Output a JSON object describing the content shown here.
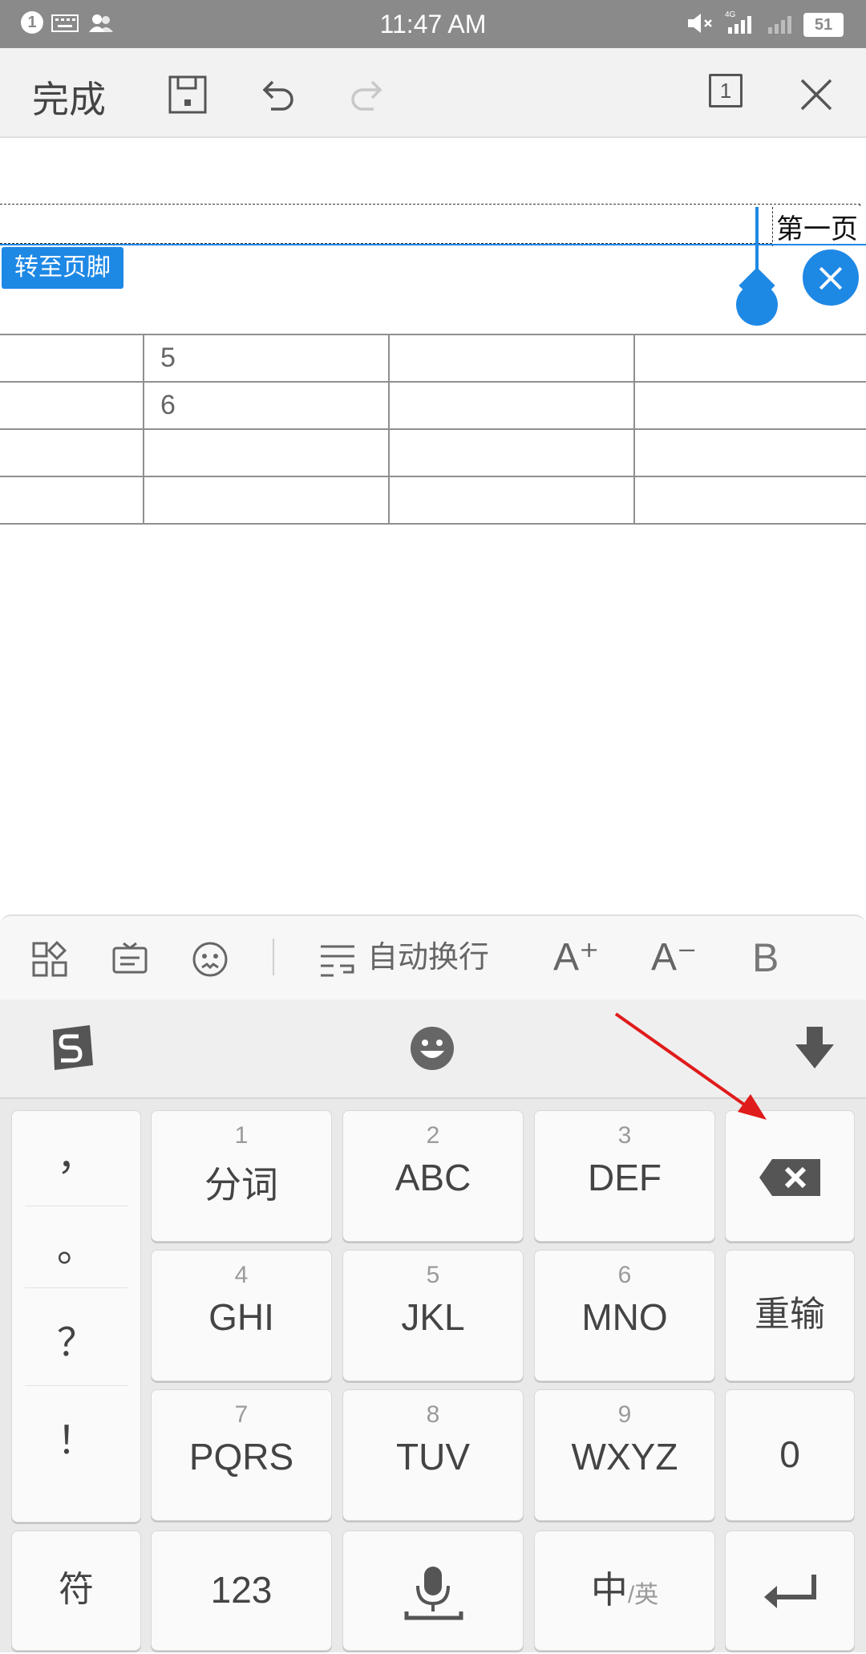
{
  "status_bar": {
    "time": "11:47 AM",
    "notification_count": "1",
    "network": "4G",
    "battery": "51"
  },
  "toolbar": {
    "done_label": "完成",
    "page_count": "1",
    "icons": [
      "save-icon",
      "undo-icon",
      "redo-icon",
      "page-count-icon",
      "close-icon"
    ]
  },
  "document": {
    "header_text": "第一页",
    "goto_footer_label": "转至页脚",
    "table": {
      "rows": [
        [
          "",
          "5",
          "",
          ""
        ],
        [
          "",
          "6",
          "",
          ""
        ],
        [
          "",
          "",
          "",
          ""
        ],
        [
          "",
          "",
          "",
          ""
        ]
      ]
    }
  },
  "format_bar": {
    "wrap_label": "自动换行",
    "increase_font": "A⁺",
    "decrease_font": "A⁻",
    "bold": "B"
  },
  "keyboard": {
    "punctuation": [
      "，",
      "。",
      "？",
      "！"
    ],
    "keys": [
      {
        "num": "1",
        "label": "分词"
      },
      {
        "num": "2",
        "label": "ABC"
      },
      {
        "num": "3",
        "label": "DEF"
      },
      {
        "num": "4",
        "label": "GHI"
      },
      {
        "num": "5",
        "label": "JKL"
      },
      {
        "num": "6",
        "label": "MNO"
      },
      {
        "num": "7",
        "label": "PQRS"
      },
      {
        "num": "8",
        "label": "TUV"
      },
      {
        "num": "9",
        "label": "WXYZ"
      }
    ],
    "retype_label": "重输",
    "zero_label": "0",
    "symbols_label": "符",
    "numbers_label": "123",
    "lang_label_main": "中",
    "lang_label_sub": "/英"
  },
  "colors": {
    "accent": "#1e88e5",
    "annotation_arrow": "#e01b1b"
  }
}
